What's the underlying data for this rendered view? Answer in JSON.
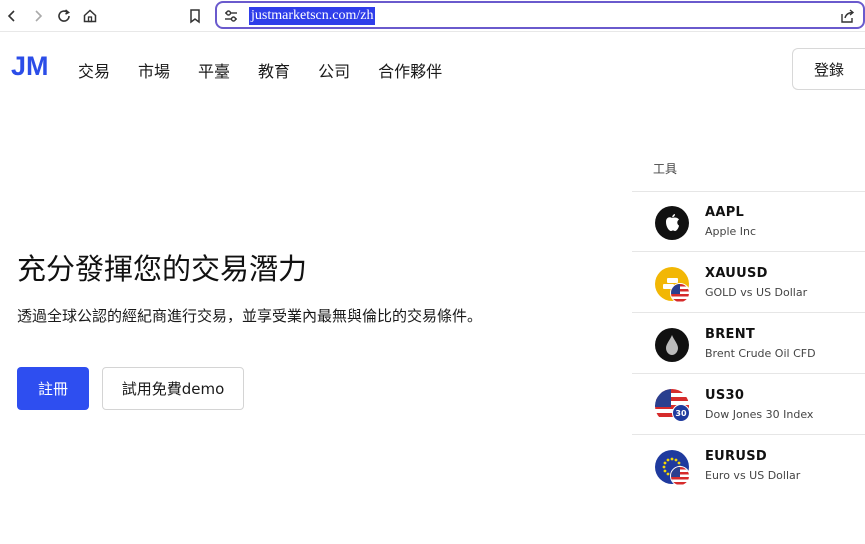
{
  "browser": {
    "url": "justmarketscn.com/zh"
  },
  "header": {
    "logo": "JM",
    "nav": [
      "交易",
      "市場",
      "平臺",
      "教育",
      "公司",
      "合作夥伴"
    ],
    "login_label": "登錄"
  },
  "hero": {
    "title": "充分發揮您的交易潛力",
    "subtitle": "透過全球公認的經紀商進行交易，並享受業內最無與倫比的交易條件。",
    "register_label": "註冊",
    "demo_label": "試用免費demo"
  },
  "instruments": {
    "label": "工具",
    "items": [
      {
        "symbol": "AAPL",
        "name": "Apple Inc",
        "icon": "apple-icon"
      },
      {
        "symbol": "XAUUSD",
        "name": "GOLD vs US Dollar",
        "icon": "gold-icon"
      },
      {
        "symbol": "BRENT",
        "name": "Brent Crude Oil CFD",
        "icon": "oil-drop-icon"
      },
      {
        "symbol": "US30",
        "name": "Dow Jones 30 Index",
        "icon": "us-flag-icon",
        "badge": "30"
      },
      {
        "symbol": "EURUSD",
        "name": "Euro vs US Dollar",
        "icon": "eu-flag-icon"
      }
    ]
  },
  "colors": {
    "brand": "#2b4de8",
    "register_button": "#2e4ef0",
    "url_border": "#6a5acd"
  }
}
